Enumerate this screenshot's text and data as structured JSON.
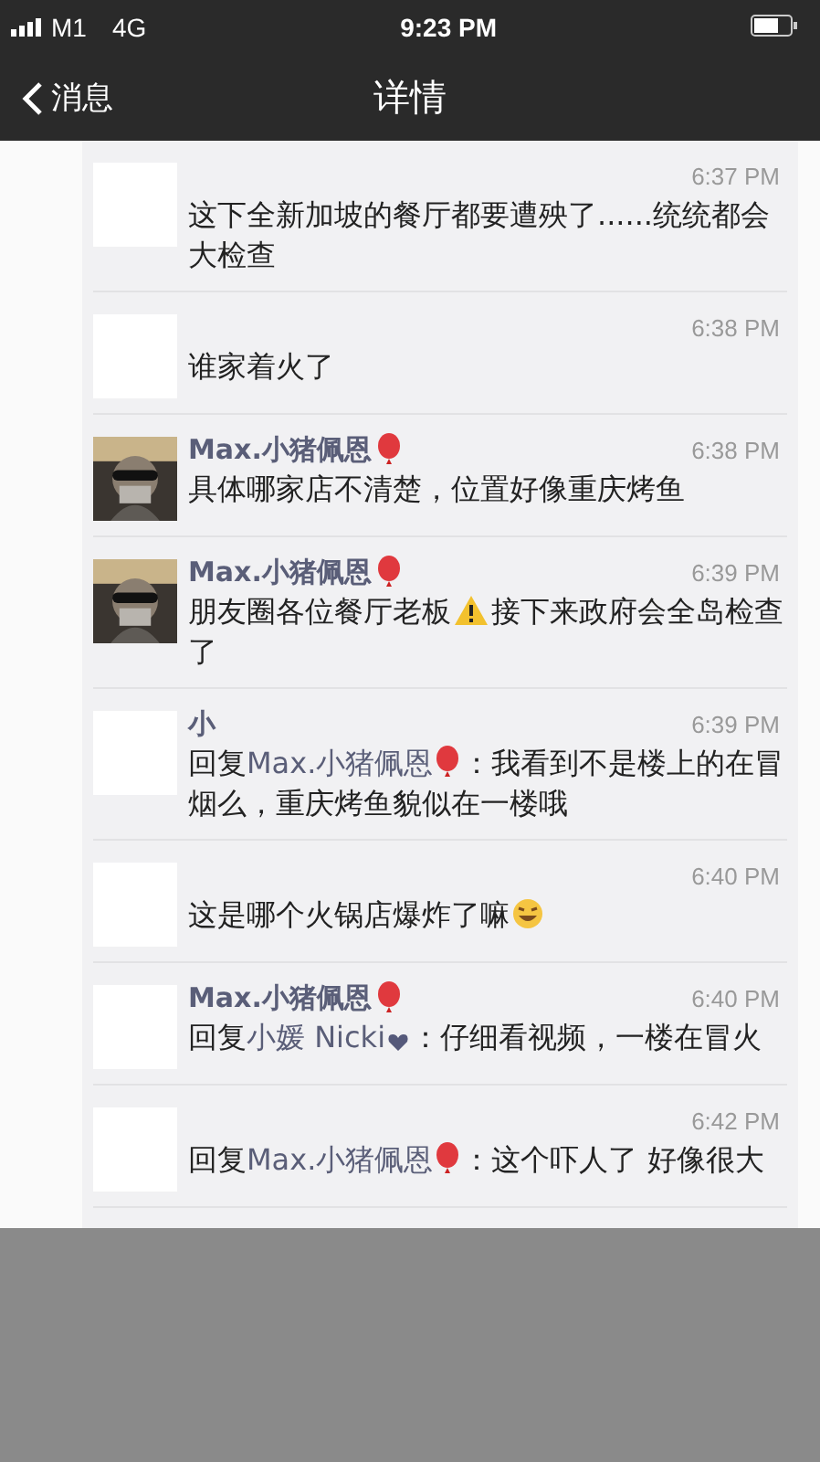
{
  "status_bar": {
    "carrier": "M1",
    "network": "4G",
    "time": "9:23 PM"
  },
  "nav": {
    "back": "消息",
    "title": "详情"
  },
  "comments": [
    {
      "avatar": {
        "kind": "blank"
      },
      "time": "6:37 PM",
      "parts": [
        {
          "kind": "text",
          "text": "这下全新加坡的餐厅都要遭殃了......统统都会大检查"
        }
      ]
    },
    {
      "avatar": {
        "kind": "blank"
      },
      "time": "6:38 PM",
      "parts": [
        {
          "kind": "text",
          "text": "谁家着火了"
        }
      ]
    },
    {
      "avatar": {
        "kind": "picture"
      },
      "name": "Max.小猪佩恩",
      "badge": {
        "kind": "balloon"
      },
      "time": "6:38 PM",
      "parts": [
        {
          "kind": "text",
          "text": "具体哪家店不清楚，位置好像重庆烤鱼"
        }
      ]
    },
    {
      "avatar": {
        "kind": "picture"
      },
      "name": "Max.小猪佩恩",
      "badge": {
        "kind": "balloon"
      },
      "time": "6:39 PM",
      "parts": [
        {
          "kind": "text",
          "text": "朋友圈各位餐厅老板"
        },
        {
          "kind": "warning"
        },
        {
          "kind": "text",
          "text": "接下来政府会全岛检查了"
        }
      ]
    },
    {
      "avatar": {
        "kind": "blank"
      },
      "name": "小",
      "time": "6:39 PM",
      "parts": [
        {
          "kind": "text",
          "text": "回复"
        },
        {
          "kind": "mention",
          "text": "Max.小猪佩恩"
        },
        {
          "kind": "balloon"
        },
        {
          "kind": "text",
          "text": "：我看到不是楼上的在冒烟么，重庆烤鱼貌似在一楼哦"
        }
      ]
    },
    {
      "avatar": {
        "kind": "blank"
      },
      "time": "6:40 PM",
      "parts": [
        {
          "kind": "text",
          "text": "这是哪个火锅店爆炸了嘛"
        },
        {
          "kind": "laugh"
        }
      ]
    },
    {
      "avatar": {
        "kind": "blank"
      },
      "name": "Max.小猪佩恩",
      "badge": {
        "kind": "balloon"
      },
      "time": "6:40 PM",
      "parts": [
        {
          "kind": "text",
          "text": "回复"
        },
        {
          "kind": "mention",
          "text": "小媛 Nicki"
        },
        {
          "kind": "heart"
        },
        {
          "kind": "text",
          "text": "：仔细看视频，一楼在冒火"
        }
      ]
    },
    {
      "avatar": {
        "kind": "blank"
      },
      "time": "6:42 PM",
      "parts": [
        {
          "kind": "text",
          "text": "回复"
        },
        {
          "kind": "mention",
          "text": "Max.小猪佩恩"
        },
        {
          "kind": "balloon"
        },
        {
          "kind": "text",
          "text": "：这个吓人了 好像很大"
        }
      ]
    }
  ]
}
